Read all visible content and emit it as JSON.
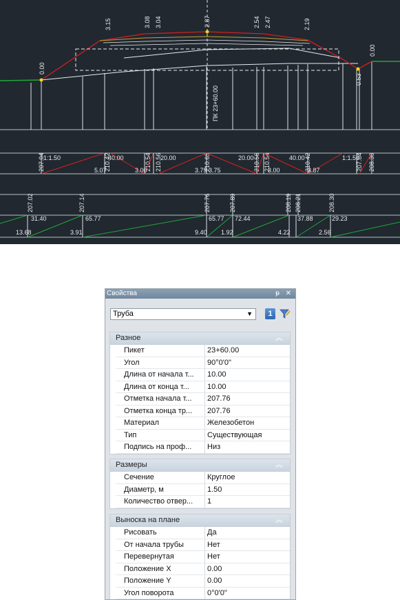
{
  "cad": {
    "top_labels": [
      "3.15",
      "3.08",
      "3.04",
      "2.87",
      "2.54",
      "2.47",
      "2.19",
      "0.00",
      "0.00"
    ],
    "picket_label": "ПК 23+60.00",
    "right_small": "0.53",
    "row1_elev": [
      "207.04",
      "210.42",
      "210.54",
      "210.56",
      "210.63",
      "210.56",
      "210.54",
      "210.42",
      "207.84",
      "208.39"
    ],
    "row2_slopes": [
      "1:1.50",
      "40.00",
      "20.00",
      "20.00",
      "40.00",
      "1:1.50"
    ],
    "row2_bottom": [
      "5.07",
      "3.00",
      "3.75",
      "3.75",
      "3.00",
      "3.87"
    ],
    "row3_elev": [
      "207.02",
      "207.14",
      "207.76",
      "207.89",
      "208.19",
      "208.21",
      "208.30"
    ],
    "row4_top": [
      "31.40",
      "65.77",
      "65.77",
      "72.44",
      "37.88",
      "29.23"
    ],
    "row4_bottom": [
      "13.68",
      "3.91",
      "9.40",
      "1.92",
      "4.22",
      "2.56"
    ]
  },
  "panel": {
    "title": "Свойства",
    "title_buttons": "ᵽ ✕",
    "select_value": "Труба",
    "info_label": "1",
    "sections": [
      {
        "header": "Разное",
        "rows": [
          {
            "k": "Пикет",
            "v": "23+60.00"
          },
          {
            "k": "Угол",
            "v": "90°0'0\""
          },
          {
            "k": "Длина от начала т...",
            "v": "10.00"
          },
          {
            "k": "Длина от конца т...",
            "v": "10.00"
          },
          {
            "k": "Отметка начала т...",
            "v": "207.76"
          },
          {
            "k": "Отметка конца тр...",
            "v": "207.76"
          },
          {
            "k": "Материал",
            "v": "Железобетон"
          },
          {
            "k": "Тип",
            "v": "Существующая"
          },
          {
            "k": "Подпись на проф...",
            "v": "Низ"
          }
        ]
      },
      {
        "header": "Размеры",
        "rows": [
          {
            "k": "Сечение",
            "v": "Круглое"
          },
          {
            "k": "Диаметр, м",
            "v": "1.50"
          },
          {
            "k": "Количество отвер...",
            "v": "1"
          }
        ]
      },
      {
        "header": "Выноска на плане",
        "rows": [
          {
            "k": "Рисовать",
            "v": "Да"
          },
          {
            "k": "От начала трубы",
            "v": "Нет"
          },
          {
            "k": "Перевернутая",
            "v": "Нет"
          },
          {
            "k": "Положение X",
            "v": "0.00"
          },
          {
            "k": "Положение Y",
            "v": "0.00"
          },
          {
            "k": "Угол поворота",
            "v": "0°0'0\""
          }
        ]
      }
    ]
  },
  "colors": {
    "cad_bg": "#212830",
    "red": "#d42020",
    "green": "#1fa83a",
    "white": "#e8ecef",
    "yellow": "#f3d41b"
  }
}
